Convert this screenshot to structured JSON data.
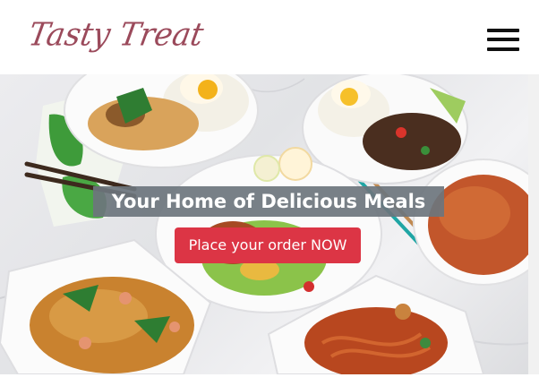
{
  "brand": {
    "name": "Tasty Treat"
  },
  "nav": {
    "menu_icon": "hamburger-menu-icon"
  },
  "hero": {
    "image": "food-platters-photo",
    "tagline": "Your Home of Delicious Meals",
    "cta_label": "Place your order NOW"
  },
  "colors": {
    "brand": "#9b4a5b",
    "cta": "#dc3545",
    "tagline_bg": "#6c757d"
  }
}
